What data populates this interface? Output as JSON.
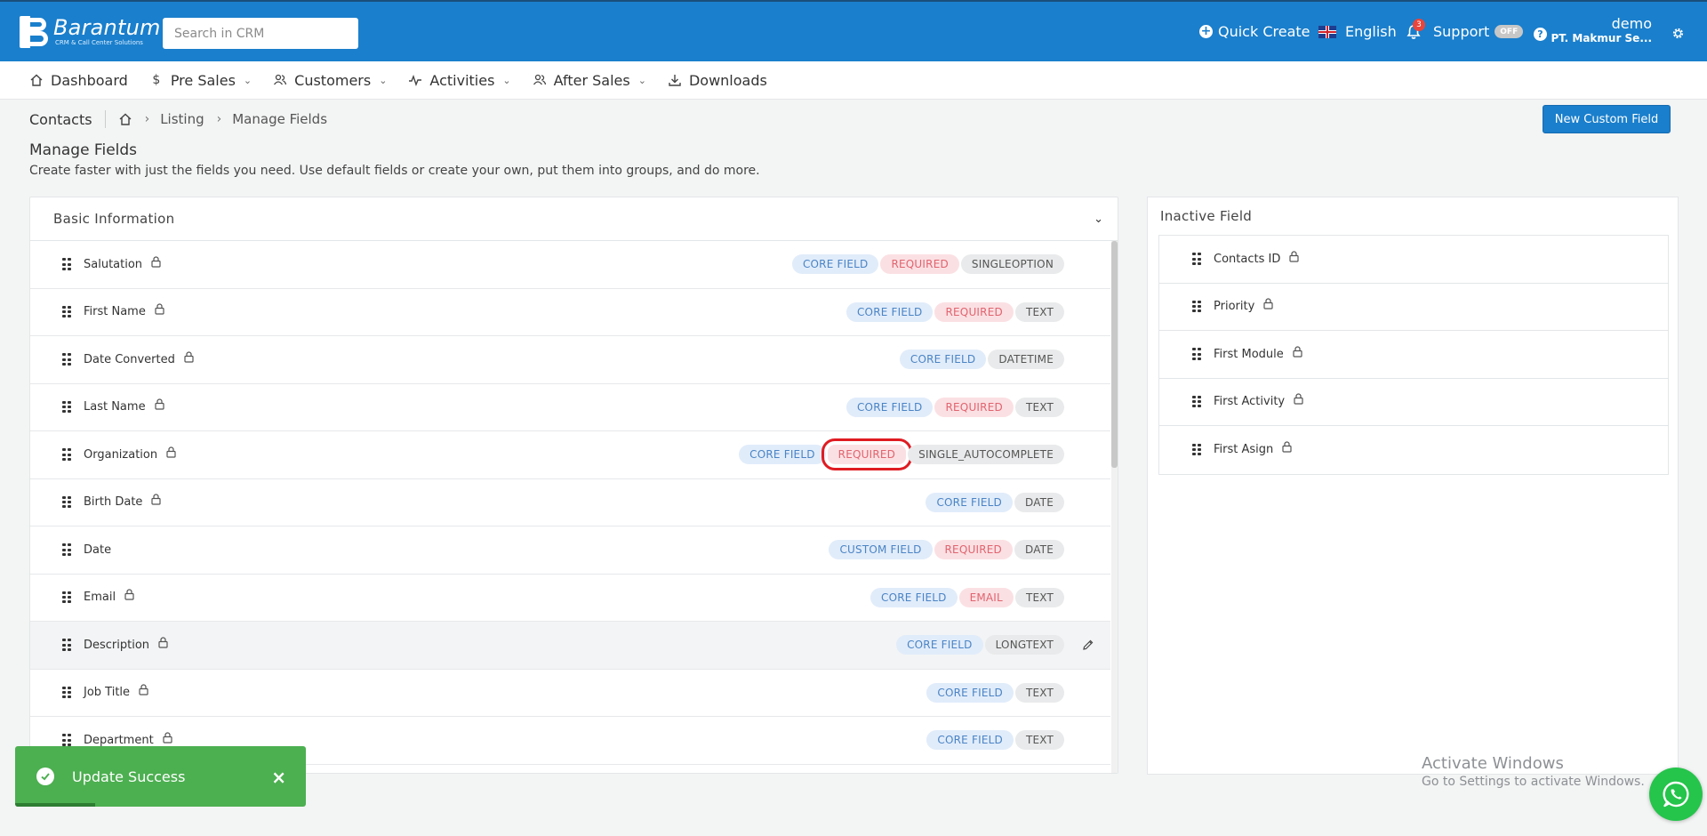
{
  "header": {
    "brand": "Barantum",
    "tagline": "CRM & Call Center Solutions",
    "search_placeholder": "Search in CRM",
    "quick_create": "Quick Create",
    "language": "English",
    "notification_count": "3",
    "support": "Support",
    "support_toggle": "OFF",
    "help": "?",
    "user_name": "demo",
    "company": "PT. Makmur Se..."
  },
  "nav": [
    {
      "label": "Dashboard",
      "icon": "home-icon"
    },
    {
      "label": "Pre Sales",
      "icon": "dollar-icon"
    },
    {
      "label": "Customers",
      "icon": "users-icon"
    },
    {
      "label": "Activities",
      "icon": "activity-icon"
    },
    {
      "label": "After Sales",
      "icon": "users-icon"
    },
    {
      "label": "Downloads",
      "icon": "download-icon"
    }
  ],
  "breadcrumb": {
    "module": "Contacts",
    "items": [
      "Listing",
      "Manage Fields"
    ]
  },
  "new_custom_field": "New Custom Field",
  "page": {
    "title": "Manage Fields",
    "description": "Create faster with just the fields you need. Use default fields or create your own, put them into groups, and do more."
  },
  "basic_info": {
    "title": "Basic Information",
    "fields": [
      {
        "name": "Salutation",
        "locked": true,
        "tags": [
          {
            "text": "CORE FIELD",
            "kind": "core"
          },
          {
            "text": "REQUIRED",
            "kind": "req"
          },
          {
            "text": "SINGLEOPTION",
            "kind": "type"
          }
        ]
      },
      {
        "name": "First Name",
        "locked": true,
        "tags": [
          {
            "text": "CORE FIELD",
            "kind": "core"
          },
          {
            "text": "REQUIRED",
            "kind": "req"
          },
          {
            "text": "TEXT",
            "kind": "type"
          }
        ]
      },
      {
        "name": "Date Converted",
        "locked": true,
        "tags": [
          {
            "text": "CORE FIELD",
            "kind": "core"
          },
          {
            "text": "DATETIME",
            "kind": "type"
          }
        ]
      },
      {
        "name": "Last Name",
        "locked": true,
        "tags": [
          {
            "text": "CORE FIELD",
            "kind": "core"
          },
          {
            "text": "REQUIRED",
            "kind": "req"
          },
          {
            "text": "TEXT",
            "kind": "type"
          }
        ]
      },
      {
        "name": "Organization",
        "locked": true,
        "tags": [
          {
            "text": "CORE FIELD",
            "kind": "core"
          },
          {
            "text": "REQUIRED",
            "kind": "req",
            "highlighted": true
          },
          {
            "text": "SINGLE_AUTOCOMPLETE",
            "kind": "type"
          }
        ]
      },
      {
        "name": "Birth Date",
        "locked": true,
        "tags": [
          {
            "text": "CORE FIELD",
            "kind": "core"
          },
          {
            "text": "DATE",
            "kind": "type"
          }
        ]
      },
      {
        "name": "Date",
        "locked": false,
        "tags": [
          {
            "text": "CUSTOM FIELD",
            "kind": "custom"
          },
          {
            "text": "REQUIRED",
            "kind": "req"
          },
          {
            "text": "DATE",
            "kind": "type"
          }
        ]
      },
      {
        "name": "Email",
        "locked": true,
        "tags": [
          {
            "text": "CORE FIELD",
            "kind": "core"
          },
          {
            "text": "EMAIL",
            "kind": "req"
          },
          {
            "text": "TEXT",
            "kind": "type"
          }
        ]
      },
      {
        "name": "Description",
        "locked": true,
        "hover": true,
        "editable": true,
        "tags": [
          {
            "text": "CORE FIELD",
            "kind": "core"
          },
          {
            "text": "LONGTEXT",
            "kind": "type"
          }
        ]
      },
      {
        "name": "Job Title",
        "locked": true,
        "tags": [
          {
            "text": "CORE FIELD",
            "kind": "core"
          },
          {
            "text": "TEXT",
            "kind": "type"
          }
        ]
      },
      {
        "name": "Department",
        "locked": true,
        "tags": [
          {
            "text": "CORE FIELD",
            "kind": "core"
          },
          {
            "text": "TEXT",
            "kind": "type"
          }
        ]
      }
    ]
  },
  "inactive": {
    "title": "Inactive Field",
    "fields": [
      "Contacts ID",
      "Priority",
      "First Module",
      "First Activity",
      "First Asign"
    ]
  },
  "watermark": {
    "line1": "Activate Windows",
    "line2": "Go to Settings to activate Windows."
  },
  "toast": {
    "message": "Update Success",
    "close": "×"
  },
  "colors": {
    "brand": "#1a7fcc",
    "success": "#4caf50",
    "required": "#e0646f",
    "core": "#4a84c5",
    "highlight": "#e01b22",
    "whatsapp": "#25c44b"
  }
}
